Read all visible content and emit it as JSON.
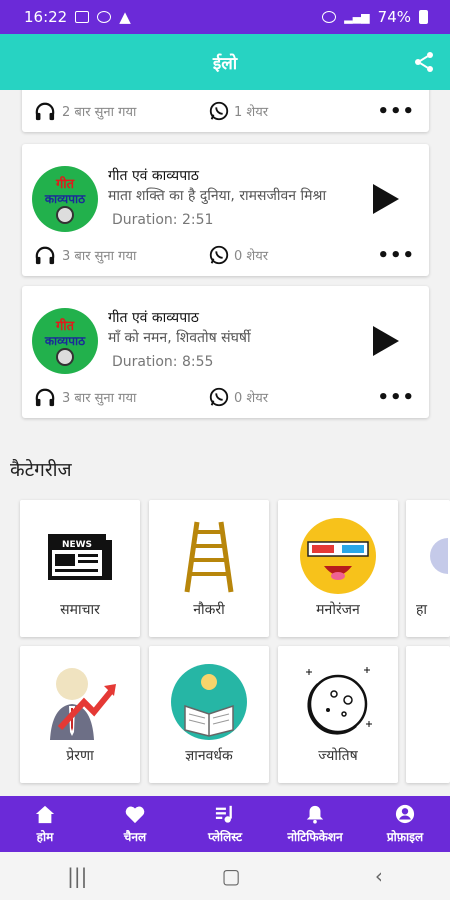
{
  "status": {
    "time": "16:22",
    "battery": "74%"
  },
  "appbar": {
    "title": "ईलो"
  },
  "cards": [
    {
      "listens": "2 बार सुना गया",
      "shares": "1 शेयर"
    },
    {
      "title": "गीत एवं काव्यपाठ",
      "subtitle": "माता शक्ति का है दुनिया, रामसजीवन मिश्रा",
      "duration": "Duration: 2:51",
      "listens": "3 बार सुना गया",
      "shares": "0 शेयर",
      "thumb_top": "गीत",
      "thumb_bottom": "काव्यपाठ"
    },
    {
      "title": "गीत एवं काव्यपाठ",
      "subtitle": "माँ को नमन, शिवतोष संघर्षी",
      "duration": "Duration: 8:55",
      "listens": "3 बार सुना गया",
      "shares": "0 शेयर",
      "thumb_top": "गीत",
      "thumb_bottom": "काव्यपाठ"
    }
  ],
  "categories_title": "कैटेगरीज",
  "categories": [
    {
      "label": "समाचार",
      "icon": "newspaper-icon",
      "news_text": "NEWS"
    },
    {
      "label": "नौकरी",
      "icon": "ladder-icon"
    },
    {
      "label": "मनोरंजन",
      "icon": "emoji-3d-glasses-icon"
    },
    {
      "label": "हा",
      "icon": "partial-icon"
    },
    {
      "label": "प्रेरणा",
      "icon": "growth-person-icon"
    },
    {
      "label": "ज्ञानवर्धक",
      "icon": "reading-book-icon"
    },
    {
      "label": "ज्योतिष",
      "icon": "moon-icon"
    }
  ],
  "nav": [
    {
      "label": "होम",
      "icon": "home-icon"
    },
    {
      "label": "चैनल",
      "icon": "heart-icon"
    },
    {
      "label": "प्लेलिस्ट",
      "icon": "playlist-icon"
    },
    {
      "label": "नोटिफिकेशन",
      "icon": "bell-icon"
    },
    {
      "label": "प्रोफ़ाइल",
      "icon": "profile-icon"
    }
  ],
  "colors": {
    "status": "#6b2ad8",
    "appbar": "#27d3c2",
    "nav": "#6b2ad8"
  }
}
